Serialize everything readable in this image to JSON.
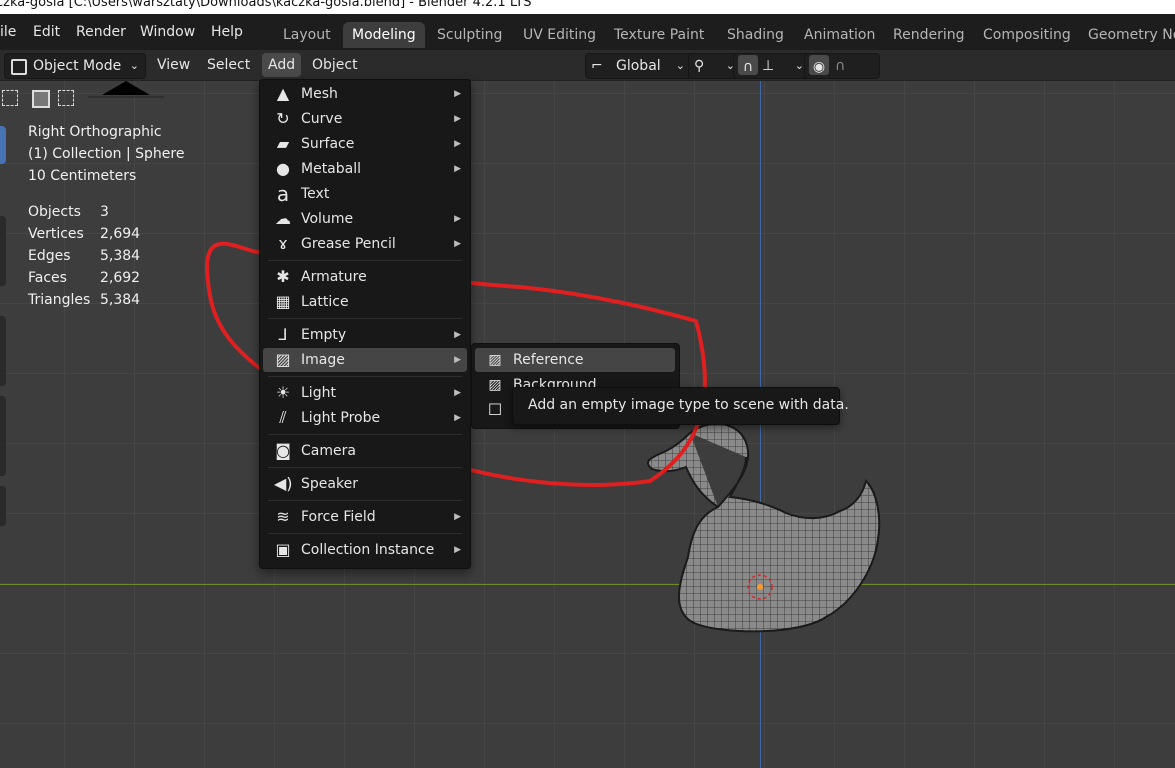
{
  "window_title": "czka-gosia [C:\\Users\\warsztaty\\Downloads\\kaczka-gosia.blend] - Blender 4.2.1 LTS",
  "top_menu": [
    "ile",
    "Edit",
    "Render",
    "Window",
    "Help"
  ],
  "workspace_tabs": [
    "Layout",
    "Modeling",
    "Sculpting",
    "UV Editing",
    "Texture Paint",
    "Shading",
    "Animation",
    "Rendering",
    "Compositing",
    "Geometry No"
  ],
  "active_workspace": "Modeling",
  "header": {
    "mode": "Object Mode",
    "view": "View",
    "select": "Select",
    "add": "Add",
    "object": "Object",
    "orientation": "Global"
  },
  "viewport": {
    "view_name": "Right Orthographic",
    "collection": "(1) Collection | Sphere",
    "scale": "10 Centimeters",
    "stats": [
      {
        "label": "Objects",
        "value": "3"
      },
      {
        "label": "Vertices",
        "value": "2,694"
      },
      {
        "label": "Edges",
        "value": "5,384"
      },
      {
        "label": "Faces",
        "value": "2,692"
      },
      {
        "label": "Triangles",
        "value": "5,384"
      }
    ]
  },
  "add_menu": {
    "items": [
      {
        "label": "Mesh",
        "icon": "mesh-icon",
        "submenu": true
      },
      {
        "label": "Curve",
        "icon": "curve-icon",
        "submenu": true
      },
      {
        "label": "Surface",
        "icon": "surface-icon",
        "submenu": true
      },
      {
        "label": "Metaball",
        "icon": "metaball-icon",
        "submenu": true
      },
      {
        "label": "Text",
        "icon": "text-icon",
        "submenu": false
      },
      {
        "label": "Volume",
        "icon": "volume-icon",
        "submenu": true
      },
      {
        "label": "Grease Pencil",
        "icon": "grease-pencil-icon",
        "submenu": true
      },
      {
        "label": "Armature",
        "icon": "armature-icon",
        "submenu": false
      },
      {
        "label": "Lattice",
        "icon": "lattice-icon",
        "submenu": false
      },
      {
        "label": "Empty",
        "icon": "empty-icon",
        "submenu": true
      },
      {
        "label": "Image",
        "icon": "image-icon",
        "submenu": true
      },
      {
        "label": "Light",
        "icon": "light-icon",
        "submenu": true
      },
      {
        "label": "Light Probe",
        "icon": "light-probe-icon",
        "submenu": true
      },
      {
        "label": "Camera",
        "icon": "camera-icon",
        "submenu": false
      },
      {
        "label": "Speaker",
        "icon": "speaker-icon",
        "submenu": false
      },
      {
        "label": "Force Field",
        "icon": "force-field-icon",
        "submenu": true
      },
      {
        "label": "Collection Instance",
        "icon": "collection-instance-icon",
        "submenu": true
      }
    ],
    "highlighted": "Image"
  },
  "image_submenu": {
    "items": [
      "Reference",
      "Background",
      ""
    ],
    "highlighted": "Reference"
  },
  "tooltip": "Add an empty image type to scene with data.",
  "colors": {
    "annotation": "#e02020",
    "highlight": "#454545",
    "menu_bg": "#181818"
  }
}
